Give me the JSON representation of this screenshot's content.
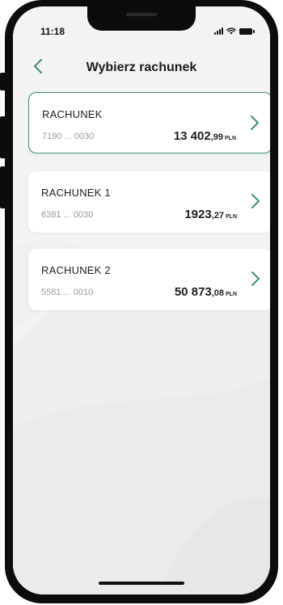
{
  "status_bar": {
    "time": "11:18"
  },
  "header": {
    "title": "Wybierz rachunek",
    "back_icon": "chevron-left-icon"
  },
  "accounts": [
    {
      "name": "RACHUNEK",
      "number": "7190 ... 0030",
      "balance_int": "13 402",
      "balance_dec": ",99",
      "currency": "PLN",
      "selected": true
    },
    {
      "name": "RACHUNEK 1",
      "number": "6381 ... 0030",
      "balance_int": "1923",
      "balance_dec": ",27",
      "currency": "PLN",
      "selected": false
    },
    {
      "name": "RACHUNEK 2",
      "number": "5581 ... 0010",
      "balance_int": "50 873",
      "balance_dec": ",08",
      "currency": "PLN",
      "selected": false
    }
  ],
  "colors": {
    "accent": "#3f8f6a",
    "background": "#f4f4f4",
    "card": "#ffffff"
  }
}
